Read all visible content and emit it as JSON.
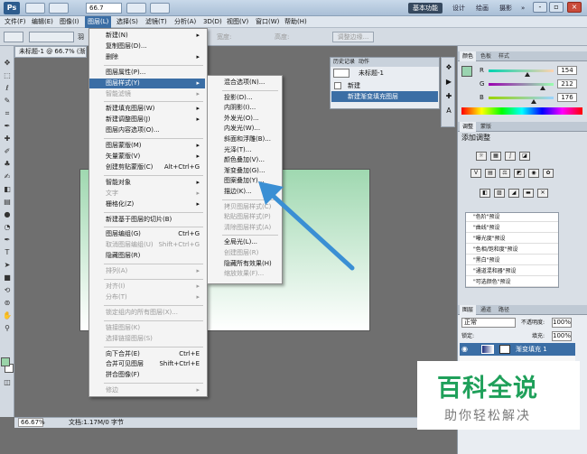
{
  "titlebar": {
    "logo": "Ps",
    "zoom": "66.7",
    "workspaces": [
      "基本功能",
      "设计",
      "绘画",
      "摄影",
      "»"
    ],
    "window_buttons": [
      "-",
      "▫",
      "×"
    ]
  },
  "menubar": {
    "items": [
      "文件(F)",
      "编辑(E)",
      "图像(I)",
      "图层(L)",
      "选择(S)",
      "滤镜(T)",
      "分析(A)",
      "3D(D)",
      "视图(V)",
      "窗口(W)",
      "帮助(H)"
    ]
  },
  "options": {
    "refine_edge": "调整边缘...",
    "feather_partial": "羽",
    "width_label": "宽度:",
    "height_label": "高度:"
  },
  "document": {
    "tab": "未标题-1 @ 66.7% (渐",
    "status_zoom": "66.67%",
    "status_doc": "文档:1.17M/0 字节"
  },
  "layer_menu": {
    "items": [
      {
        "label": "新建(N)",
        "arrow": true
      },
      {
        "label": "复制图层(D)..."
      },
      {
        "label": "删除",
        "arrow": true
      },
      {
        "sep": true
      },
      {
        "label": "图层属性(P)..."
      },
      {
        "label": "图层样式(Y)",
        "arrow": true,
        "highlight": true
      },
      {
        "label": "智能滤镜",
        "disabled": true,
        "arrow": true
      },
      {
        "sep": true
      },
      {
        "label": "新建填充图层(W)",
        "arrow": true
      },
      {
        "label": "新建调整图层(J)",
        "arrow": true
      },
      {
        "label": "图层内容选项(O)..."
      },
      {
        "sep": true
      },
      {
        "label": "图层蒙版(M)",
        "arrow": true
      },
      {
        "label": "矢量蒙版(V)",
        "arrow": true
      },
      {
        "label": "创建剪贴蒙版(C)",
        "shortcut": "Alt+Ctrl+G"
      },
      {
        "sep": true
      },
      {
        "label": "智能对象",
        "arrow": true
      },
      {
        "label": "文字",
        "disabled": true,
        "arrow": true
      },
      {
        "label": "栅格化(Z)",
        "arrow": true
      },
      {
        "sep": true
      },
      {
        "label": "新建基于图层的切片(B)"
      },
      {
        "sep": true
      },
      {
        "label": "图层编组(G)",
        "shortcut": "Ctrl+G"
      },
      {
        "label": "取消图层编组(U)",
        "shortcut": "Shift+Ctrl+G",
        "disabled": true
      },
      {
        "label": "隐藏图层(R)"
      },
      {
        "sep": true
      },
      {
        "label": "排列(A)",
        "disabled": true,
        "arrow": true
      },
      {
        "sep": true
      },
      {
        "label": "对齐(I)",
        "disabled": true,
        "arrow": true
      },
      {
        "label": "分布(T)",
        "disabled": true,
        "arrow": true
      },
      {
        "sep": true
      },
      {
        "label": "锁定组内的所有图层(X)...",
        "disabled": true
      },
      {
        "sep": true
      },
      {
        "label": "链接图层(K)",
        "disabled": true
      },
      {
        "label": "选择链接图层(S)",
        "disabled": true
      },
      {
        "sep": true
      },
      {
        "label": "向下合并(E)",
        "shortcut": "Ctrl+E"
      },
      {
        "label": "合并可见图层",
        "shortcut": "Shift+Ctrl+E"
      },
      {
        "label": "拼合图像(F)"
      },
      {
        "sep": true
      },
      {
        "label": "修边",
        "disabled": true,
        "arrow": true
      }
    ]
  },
  "style_menu": {
    "items": [
      {
        "label": "混合选项(N)..."
      },
      {
        "sep": true
      },
      {
        "label": "投影(D)..."
      },
      {
        "label": "内阴影(I)..."
      },
      {
        "label": "外发光(O)..."
      },
      {
        "label": "内发光(W)..."
      },
      {
        "label": "斜面和浮雕(B)..."
      },
      {
        "label": "光泽(T)..."
      },
      {
        "label": "颜色叠加(V)..."
      },
      {
        "label": "渐变叠加(G)..."
      },
      {
        "label": "图案叠加(Y)..."
      },
      {
        "label": "描边(K)..."
      },
      {
        "sep": true
      },
      {
        "label": "拷贝图层样式(C)",
        "disabled": true
      },
      {
        "label": "粘贴图层样式(P)",
        "disabled": true
      },
      {
        "label": "清除图层样式(A)",
        "disabled": true
      },
      {
        "sep": true
      },
      {
        "label": "全局光(L)..."
      },
      {
        "label": "创建图层(R)",
        "disabled": true
      },
      {
        "label": "隐藏所有效果(H)"
      },
      {
        "label": "缩放效果(F)...",
        "disabled": true
      }
    ]
  },
  "history": {
    "tabs": [
      "历史记录",
      "动作"
    ],
    "snapshot": "未标题-1",
    "rows": [
      "新建",
      "新建渐变填充图层"
    ]
  },
  "color_panel": {
    "tabs": [
      "颜色",
      "色板",
      "样式"
    ],
    "channels": [
      {
        "label": "R",
        "value": "154",
        "from": "#00d4b0",
        "to": "#ffd4b0"
      },
      {
        "label": "G",
        "value": "212",
        "from": "#9a00b0",
        "to": "#9affb0"
      },
      {
        "label": "B",
        "value": "176",
        "from": "#9ad400",
        "to": "#9ad4ff"
      }
    ]
  },
  "adjust_panel": {
    "tabs": [
      "调整",
      "蒙版"
    ],
    "title": "添加调整",
    "presets": [
      "\"色阶\"预设",
      "\"曲线\"预设",
      "\"曝光度\"预设",
      "\"色相/饱和度\"预设",
      "\"黑白\"预设",
      "\"通道混和器\"预设",
      "\"可选颜色\"预设"
    ]
  },
  "layers_panel": {
    "tabs": [
      "图层",
      "通道",
      "路径"
    ],
    "blend_mode": "正常",
    "opacity_label": "不透明度:",
    "opacity": "100%",
    "lock_label": "锁定:",
    "fill_label": "填充:",
    "fill": "100%",
    "layer_name": "渐变填充 1"
  },
  "watermark": {
    "big": "百科全说",
    "small": "助你轻松解决"
  },
  "colors": {
    "accent": "#3b6ea5",
    "foreground": "#9ad4b0",
    "arrow": "#3a8fd4"
  }
}
